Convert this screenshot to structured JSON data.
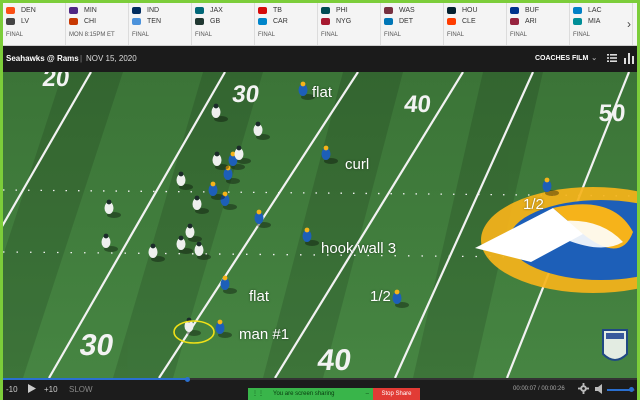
{
  "scoreboard": {
    "games": [
      {
        "away": {
          "abbr": "DEN",
          "logo": "broncos-logo",
          "color": "#fb4f14"
        },
        "home": {
          "abbr": "LV",
          "logo": "raiders-logo",
          "color": "#444444"
        },
        "status": "FINAL"
      },
      {
        "away": {
          "abbr": "MIN",
          "logo": "vikings-logo",
          "color": "#4f2683"
        },
        "home": {
          "abbr": "CHI",
          "logo": "bears-logo",
          "color": "#c83803"
        },
        "status": "MON 8:15PM ET"
      },
      {
        "away": {
          "abbr": "IND",
          "logo": "colts-logo",
          "color": "#002c5f"
        },
        "home": {
          "abbr": "TEN",
          "logo": "titans-logo",
          "color": "#4b92db"
        },
        "status": "FINAL"
      },
      {
        "away": {
          "abbr": "JAX",
          "logo": "jaguars-logo",
          "color": "#006778"
        },
        "home": {
          "abbr": "GB",
          "logo": "packers-logo",
          "color": "#203731"
        },
        "status": "FINAL"
      },
      {
        "away": {
          "abbr": "TB",
          "logo": "buccaneers-logo",
          "color": "#d50a0a"
        },
        "home": {
          "abbr": "CAR",
          "logo": "panthers-logo",
          "color": "#0085ca"
        },
        "status": "FINAL"
      },
      {
        "away": {
          "abbr": "PHI",
          "logo": "eagles-logo",
          "color": "#004c54"
        },
        "home": {
          "abbr": "NYG",
          "logo": "giants-logo",
          "color": "#a71930"
        },
        "status": "FINAL"
      },
      {
        "away": {
          "abbr": "WAS",
          "logo": "washington-logo",
          "color": "#773141"
        },
        "home": {
          "abbr": "DET",
          "logo": "lions-logo",
          "color": "#0076b6"
        },
        "status": "FINAL"
      },
      {
        "away": {
          "abbr": "HOU",
          "logo": "texans-logo",
          "color": "#03202f"
        },
        "home": {
          "abbr": "CLE",
          "logo": "browns-logo",
          "color": "#ff3c00"
        },
        "status": "FINAL"
      },
      {
        "away": {
          "abbr": "BUF",
          "logo": "bills-logo",
          "color": "#00338d"
        },
        "home": {
          "abbr": "ARI",
          "logo": "cardinals-logo",
          "color": "#97233f"
        },
        "status": "FINAL"
      },
      {
        "away": {
          "abbr": "LAC",
          "logo": "chargers-logo",
          "color": "#0080c6"
        },
        "home": {
          "abbr": "MIA",
          "logo": "dolphins-logo",
          "color": "#008e97"
        },
        "status": "FINAL"
      }
    ],
    "next_icon": "chevron-right-icon"
  },
  "titlebar": {
    "title": "Seahawks @ Rams",
    "separator": "|",
    "date": "NOV 15, 2020",
    "view_label": "COACHES FILM",
    "view_icon": "chevron-down-icon",
    "icons": [
      "list-icon",
      "bar-chart-icon"
    ]
  },
  "field": {
    "yard_numbers": [
      "20",
      "30",
      "40",
      "50",
      "30",
      "40"
    ],
    "route_labels": [
      "flat",
      "curl",
      "1/2",
      "hook wall 3",
      "flat",
      "1/2",
      "man #1"
    ],
    "colors": {
      "turf": "#3f7a3b",
      "rams_blue": "#1d5fb8",
      "rams_gold": "#f6b31a",
      "highlight": "#f0e017"
    }
  },
  "controls": {
    "back_label": "-10",
    "play_icon": "play-icon",
    "forward_label": "+10",
    "slow_label": "SLOW",
    "progress": 0.29,
    "share_message": "You are screen sharing",
    "stop_share_label": "Stop Share",
    "time": "00:00:07 / 00:00:26",
    "settings_icon": "gear-icon",
    "volume_icon": "volume-icon",
    "volume_level": 0.85
  }
}
